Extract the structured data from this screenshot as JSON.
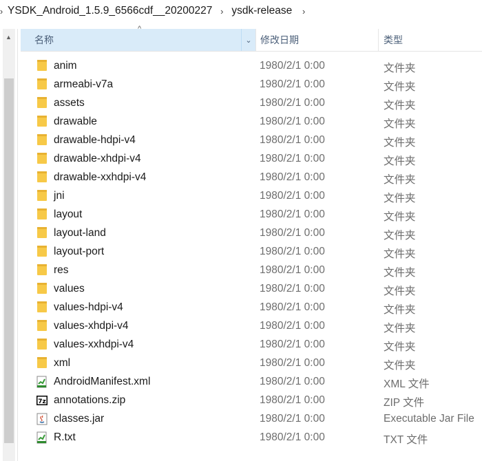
{
  "breadcrumb": {
    "items": [
      "YSDK_Android_1.5.9_6566cdf__20200227",
      "ysdk-release"
    ]
  },
  "columns": {
    "name": "名称",
    "date": "修改日期",
    "type": "类型"
  },
  "files": [
    {
      "name": "anim",
      "date": "1980/2/1 0:00",
      "type": "文件夹",
      "icon": "folder-icon"
    },
    {
      "name": "armeabi-v7a",
      "date": "1980/2/1 0:00",
      "type": "文件夹",
      "icon": "folder-icon"
    },
    {
      "name": "assets",
      "date": "1980/2/1 0:00",
      "type": "文件夹",
      "icon": "folder-icon"
    },
    {
      "name": "drawable",
      "date": "1980/2/1 0:00",
      "type": "文件夹",
      "icon": "folder-icon"
    },
    {
      "name": "drawable-hdpi-v4",
      "date": "1980/2/1 0:00",
      "type": "文件夹",
      "icon": "folder-icon"
    },
    {
      "name": "drawable-xhdpi-v4",
      "date": "1980/2/1 0:00",
      "type": "文件夹",
      "icon": "folder-icon"
    },
    {
      "name": "drawable-xxhdpi-v4",
      "date": "1980/2/1 0:00",
      "type": "文件夹",
      "icon": "folder-icon"
    },
    {
      "name": "jni",
      "date": "1980/2/1 0:00",
      "type": "文件夹",
      "icon": "folder-icon"
    },
    {
      "name": "layout",
      "date": "1980/2/1 0:00",
      "type": "文件夹",
      "icon": "folder-icon"
    },
    {
      "name": "layout-land",
      "date": "1980/2/1 0:00",
      "type": "文件夹",
      "icon": "folder-icon"
    },
    {
      "name": "layout-port",
      "date": "1980/2/1 0:00",
      "type": "文件夹",
      "icon": "folder-icon"
    },
    {
      "name": "res",
      "date": "1980/2/1 0:00",
      "type": "文件夹",
      "icon": "folder-icon"
    },
    {
      "name": "values",
      "date": "1980/2/1 0:00",
      "type": "文件夹",
      "icon": "folder-icon"
    },
    {
      "name": "values-hdpi-v4",
      "date": "1980/2/1 0:00",
      "type": "文件夹",
      "icon": "folder-icon"
    },
    {
      "name": "values-xhdpi-v4",
      "date": "1980/2/1 0:00",
      "type": "文件夹",
      "icon": "folder-icon"
    },
    {
      "name": "values-xxhdpi-v4",
      "date": "1980/2/1 0:00",
      "type": "文件夹",
      "icon": "folder-icon"
    },
    {
      "name": "xml",
      "date": "1980/2/1 0:00",
      "type": "文件夹",
      "icon": "folder-icon"
    },
    {
      "name": "AndroidManifest.xml",
      "date": "1980/2/1 0:00",
      "type": "XML 文件",
      "icon": "xml-file-icon"
    },
    {
      "name": "annotations.zip",
      "date": "1980/2/1 0:00",
      "type": "ZIP 文件",
      "icon": "zip-7z-icon"
    },
    {
      "name": "classes.jar",
      "date": "1980/2/1 0:00",
      "type": "Executable Jar File",
      "icon": "java-jar-icon"
    },
    {
      "name": "R.txt",
      "date": "1980/2/1 0:00",
      "type": "TXT 文件",
      "icon": "txt-file-icon"
    }
  ],
  "colors": {
    "folder": "#f7c948",
    "header_active": "#d9ebf9",
    "header_text": "#4c607a",
    "secondary_text": "#6d6d6d"
  }
}
